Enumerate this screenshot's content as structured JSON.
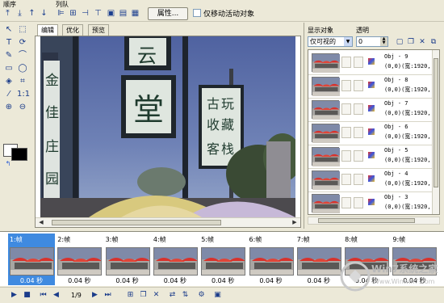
{
  "toolbar": {
    "order_label": "顺序",
    "align_label": "列队",
    "properties_label": "属性...",
    "move_active_only_label": "仅移动活动对象",
    "order_icons": [
      "bring-to-front-icon",
      "send-to-back-icon",
      "bring-forward-icon",
      "send-backward-icon"
    ],
    "align_icons": [
      "align-left-icon",
      "align-center-icon",
      "align-right-icon",
      "align-top-icon",
      "align-middle-icon",
      "align-bottom-icon"
    ]
  },
  "editor": {
    "tabs": [
      {
        "label": "编辑",
        "active": true
      },
      {
        "label": "优化",
        "active": false
      },
      {
        "label": "预览",
        "active": false
      }
    ]
  },
  "panel": {
    "display_objects_label": "显示对象",
    "opacity_label": "透明",
    "view_select_value": "仅可视的",
    "opacity_value": "0",
    "objects": [
      {
        "name": "Obj - 9",
        "info": "(0,0)(宽:1920,"
      },
      {
        "name": "Obj - 8",
        "info": "(0,0)(宽:1920,"
      },
      {
        "name": "Obj - 7",
        "info": "(0,0)(宽:1920,"
      },
      {
        "name": "Obj - 6",
        "info": "(0,0)(宽:1920,"
      },
      {
        "name": "Obj - 5",
        "info": "(0,0)(宽:1920,"
      },
      {
        "name": "Obj - 4",
        "info": "(0,0)(宽:1920,"
      },
      {
        "name": "Obj - 3",
        "info": "(0,0)(宽:1920,"
      }
    ]
  },
  "frames": [
    {
      "title": "1:帧",
      "time": "0.04 秒",
      "selected": true
    },
    {
      "title": "2:帧",
      "time": "0.04 秒",
      "selected": false
    },
    {
      "title": "3:帧",
      "time": "0.04 秒",
      "selected": false
    },
    {
      "title": "4:帧",
      "time": "0.04 秒",
      "selected": false
    },
    {
      "title": "5:帧",
      "time": "0.04 秒",
      "selected": false
    },
    {
      "title": "6:帧",
      "time": "0.04 秒",
      "selected": false
    },
    {
      "title": "7:帧",
      "time": "0.04 秒",
      "selected": false
    },
    {
      "title": "8:帧",
      "time": "0.04 秒",
      "selected": false
    },
    {
      "title": "9:帧",
      "time": "0.04 秒",
      "selected": false
    }
  ],
  "playbar": {
    "page": "1/9"
  },
  "canvas": {
    "sign_top": "云",
    "sign_mid": "堂",
    "sign_right_line1": "古玩",
    "sign_right_line2": "收藏",
    "sign_right_line3": "客栈",
    "left_signs": [
      "金",
      "佳",
      "庄",
      "园"
    ]
  },
  "watermark": {
    "text": "Win7系统之家",
    "url": "Www.Winwin7.com"
  },
  "colors": {
    "sky": "#5b6fa8",
    "selected_frame": "#3f8ae0",
    "sign_bg": "#dfe6df",
    "sign_text": "#1f3b2e"
  }
}
